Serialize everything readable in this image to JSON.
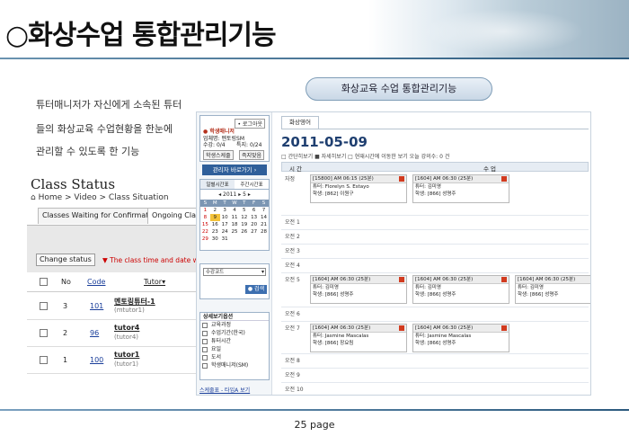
{
  "title": "○화상수업 통합관리기능",
  "subtitle_pill": "화상교육 수업 통합관리기능",
  "description": [
    "튜터매니저가 자신에게 소속된 튜터",
    "들의 화상교육 수업현황을 한눈에",
    "관리할 수 있도록 한 기능"
  ],
  "class_status": {
    "title": "Class Status",
    "breadcrumb": "Home > Video > Class Situation",
    "tabs": [
      "Classes Waiting for Confirmation",
      "Ongoing Clas"
    ],
    "change_status": "Change status",
    "note": "▼ The class time and date will",
    "headers": {
      "no": "No",
      "code": "Code",
      "tutor": "Tutor▾"
    },
    "rows": [
      {
        "no": "3",
        "code": "101",
        "tutor": "멘토링튜터-1",
        "sub": "(mtutor1)"
      },
      {
        "no": "2",
        "code": "96",
        "tutor": "tutor4",
        "sub": "(tutor4)"
      },
      {
        "no": "1",
        "code": "100",
        "tutor": "tutor1",
        "sub": "(tutor1)"
      }
    ]
  },
  "manager": {
    "logout": "• 로그아웃",
    "role": "● 학생매니저",
    "company": "업체명: 멘토링SM",
    "assign": "수강: 0/4",
    "wait": "특지: 0/24",
    "btn1": "학생스케줄",
    "btn2": "즉지맞음",
    "list_btn": "관리자 바로가기 ›"
  },
  "calendar": {
    "tab1": "일별시간표",
    "tab2": "주간시간표",
    "month": "◂ 2011 ▸ 5 ▸",
    "days": [
      "S",
      "M",
      "T",
      "W",
      "T",
      "F",
      "S"
    ],
    "weeks": [
      [
        "1",
        "2",
        "3",
        "4",
        "5",
        "6",
        "7"
      ],
      [
        "8",
        "9",
        "10",
        "11",
        "12",
        "13",
        "14"
      ],
      [
        "15",
        "16",
        "17",
        "18",
        "19",
        "20",
        "21"
      ],
      [
        "22",
        "23",
        "24",
        "25",
        "26",
        "27",
        "28"
      ],
      [
        "29",
        "30",
        "31",
        "",
        "",
        "",
        ""
      ]
    ]
  },
  "filter": {
    "select": "수강코드",
    "go": "● 검색"
  },
  "options": {
    "title": "상세보기옵션",
    "items": [
      "교육과정",
      "수업기간(한국)",
      "튜터시간",
      "요일",
      "도서",
      "학생매니저(SM)"
    ],
    "link": "스케줄표 - 타입A 보기"
  },
  "main": {
    "tab": "화상영어",
    "date": "2011-05-09",
    "opts": "□ 간단히보기  ■ 자세히보기  □ 현재시간에 이동한 보기     오늘 강의수: 0 건",
    "col_time": "시 간",
    "col_class": "수 업",
    "times": [
      "자정",
      "오전 1",
      "오전 2",
      "오전 3",
      "오전 4",
      "오전 5",
      "오전 6",
      "오전 7",
      "오전 8",
      "오전 9",
      "오전 10"
    ],
    "slots": [
      {
        "row": 0,
        "col": 0,
        "head": "[15800] AM 06:15 (25분)",
        "tutor": "튜터: Florelyn S. Estayo",
        "student": "학생: [862] 이원구"
      },
      {
        "row": 0,
        "col": 1,
        "head": "[1604] AM 06:30 (25분)",
        "tutor": "튜터: 김미영",
        "student": "학생: [866] 성명주"
      },
      {
        "row": 5,
        "col": 0,
        "head": "[1604] AM 06:30 (25분)",
        "tutor": "튜터: 김미영",
        "student": "학생: [866] 성명주"
      },
      {
        "row": 5,
        "col": 1,
        "head": "[1604] AM 06:30 (25분)",
        "tutor": "튜터: 김미영",
        "student": "학생: [866] 성명주"
      },
      {
        "row": 5,
        "col": 2,
        "head": "[1604] AM 06:30 (25분)",
        "tutor": "튜터: 김미영",
        "student": "학생: [866] 성명주"
      },
      {
        "row": 7,
        "col": 0,
        "head": "[1604] AM 06:30 (25분)",
        "tutor": "튜터: Jasmine Mascalas",
        "student": "학생: [866] 장요림"
      },
      {
        "row": 7,
        "col": 1,
        "head": "[1604] AM 06:30 (25분)",
        "tutor": "튜터: Jasmine Mascalas",
        "student": "학생: [866] 성명주"
      }
    ]
  },
  "page": "25 page"
}
